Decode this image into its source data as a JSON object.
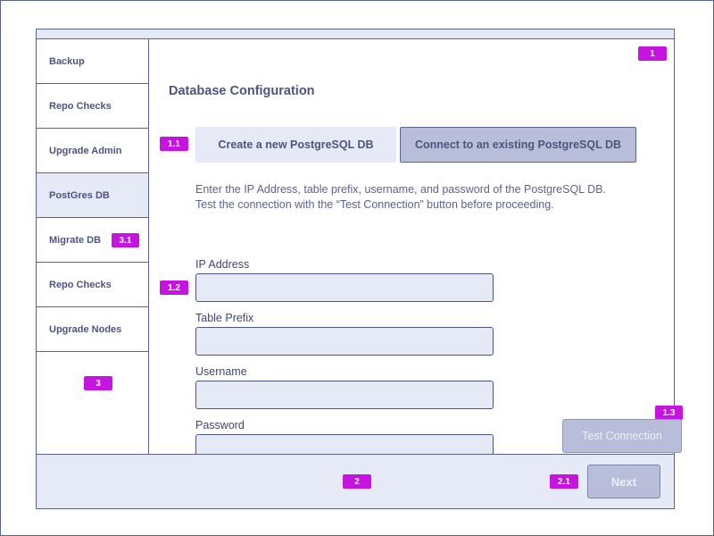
{
  "sidebar": {
    "items": [
      {
        "label": "Backup"
      },
      {
        "label": "Repo Checks"
      },
      {
        "label": "Upgrade Admin"
      },
      {
        "label": "PostGres DB"
      },
      {
        "label": "Migrate DB"
      },
      {
        "label": "Repo Checks"
      },
      {
        "label": "Upgrade Nodes"
      }
    ],
    "active_index": 3
  },
  "annotations": {
    "main": "1",
    "connection_mode": "1.1",
    "fields": "1.2",
    "test_button": "1.3",
    "footer": "2",
    "next_button": "2.1",
    "sidebar": "3",
    "migrate_item": "3.1"
  },
  "main": {
    "title": "Database Configuration",
    "mode_buttons": {
      "create_label": "Create a new PostgreSQL DB",
      "connect_label": "Connect to an existing PostgreSQL DB",
      "selected": "connect"
    },
    "description_line1": "Enter the IP Address, table prefix, username, and password of the PostgreSQL DB.",
    "description_line2": "Test the connection with the “Test Connection” button before proceeding.",
    "fields": {
      "ip_address": {
        "label": "IP Address",
        "value": "",
        "placeholder": ""
      },
      "table_prefix": {
        "label": "Table Prefix",
        "value": "",
        "placeholder": ""
      },
      "username": {
        "label": "Username",
        "value": "",
        "placeholder": ""
      },
      "password": {
        "label": "Password",
        "value": "",
        "placeholder": ""
      }
    },
    "test_connection_label": "Test Connection"
  },
  "footer": {
    "next_label": "Next"
  },
  "colors": {
    "accent_badge": "#c514e0",
    "panel_bg": "#e6e9f6",
    "border": "#5b6392",
    "text": "#4d557f",
    "disabled_button": "#b8bdd9"
  }
}
